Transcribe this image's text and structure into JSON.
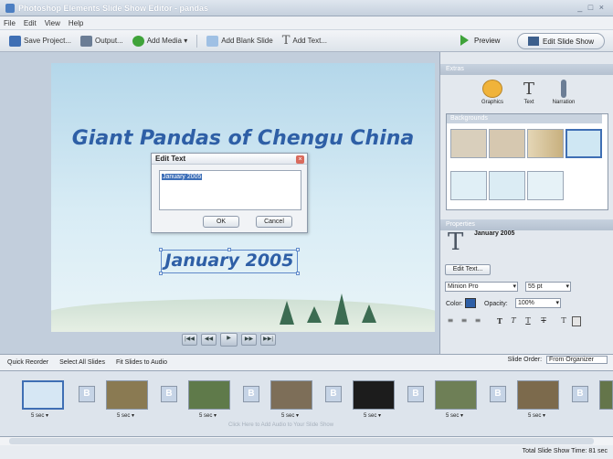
{
  "window": {
    "title": "Photoshop Elements Slide Show Editor - pandas",
    "controls": "_ □ ×"
  },
  "menu": [
    "File",
    "Edit",
    "View",
    "Help"
  ],
  "toolbar": {
    "save": "Save Project...",
    "output": "Output...",
    "add_media": "Add Media ▾",
    "add_blank": "Add Blank Slide",
    "add_text": "Add Text...",
    "preview": "Preview",
    "edit_slide_show": "Edit Slide Show"
  },
  "canvas": {
    "title": "Giant Pandas of Chengu China",
    "date_text": "January 2005"
  },
  "edit_text_dialog": {
    "title": "Edit Text",
    "value": "January 2005",
    "ok": "OK",
    "cancel": "Cancel"
  },
  "right_panel": {
    "extras_header": "Extras",
    "extras": [
      "Graphics",
      "Text",
      "Narration"
    ],
    "backgrounds_header": "Backgrounds",
    "properties_header": "Properties",
    "selected_item": "January 2005",
    "edit_text_button": "Edit Text...",
    "font": "Minion Pro",
    "size": "55 pt",
    "color_label": "Color:",
    "opacity_label": "Opacity:",
    "opacity_value": "100%"
  },
  "storyboard": {
    "quick_reorder": "Quick Reorder",
    "select_all": "Select All Slides",
    "fit_audio": "Fit Slides to Audio",
    "slide_order_label": "Slide Order:",
    "slide_order_value": "From Organizer",
    "add_audio_hint": "Click Here to Add Audio to Your Slide Show",
    "transition_label": "B",
    "durations": [
      "5 sec ▾",
      "5 sec ▾",
      "5 sec ▾",
      "5 sec ▾",
      "5 sec ▾",
      "5 sec ▾",
      "5 sec ▾",
      "5 sec ▾"
    ]
  },
  "status": {
    "total_time": "Total Slide Show Time: 81 sec"
  },
  "colors": {
    "accent": "#2e5fa6",
    "preview_green": "#3fa33a",
    "panel_bg": "#e3e8ee"
  }
}
